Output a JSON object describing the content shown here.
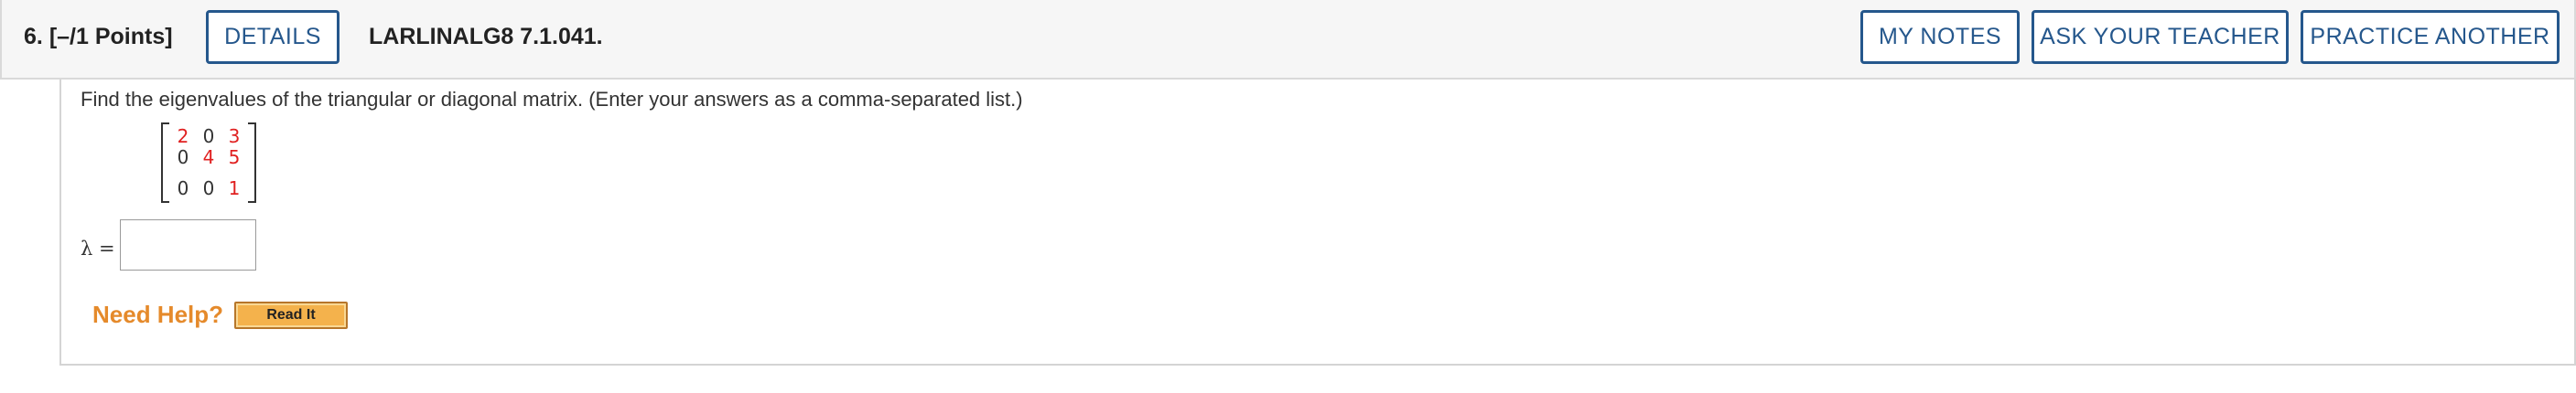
{
  "header": {
    "question_number": "6.",
    "points": "[–/1 Points]",
    "details_label": "DETAILS",
    "question_code": "LARLINALG8 7.1.041.",
    "my_notes_label": "MY NOTES",
    "ask_teacher_label": "ASK YOUR TEACHER",
    "practice_another_label": "PRACTICE ANOTHER"
  },
  "question": {
    "prompt": "Find the eigenvalues of the triangular or diagonal matrix. (Enter your answers as a comma-separated list.)",
    "matrix": [
      [
        "2",
        "0",
        "3"
      ],
      [
        "0",
        "4",
        "5"
      ],
      [
        "0",
        "0",
        "1"
      ]
    ],
    "answer_label": "λ =",
    "answer_value": ""
  },
  "help": {
    "need_help_label": "Need Help?",
    "read_it_label": "Read It"
  },
  "colors": {
    "accent_blue": "#25578c",
    "highlight_red": "#e02020",
    "help_orange": "#e58a2b",
    "read_it_button": "#f4b24c"
  }
}
